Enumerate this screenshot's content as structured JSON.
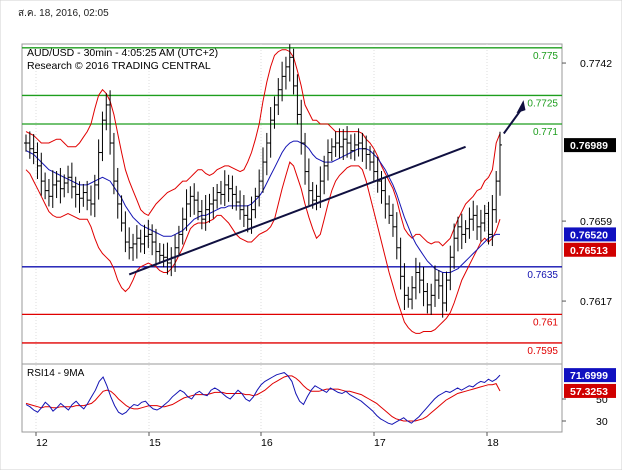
{
  "page": {
    "datestamp": "ส.ค. 18, 2016, 02:05"
  },
  "chart_data": {
    "type": "candlestick",
    "title": "AUD/USD - 30min - 4:05:25 AM (UTC+2)",
    "subtitle": "Research © 2016 TRADING CENTRAL",
    "xlabel": "",
    "ylabel": "",
    "x_ticks": [
      "12",
      "15",
      "16",
      "17",
      "18"
    ],
    "price_axis": {
      "ylim": [
        0.7585,
        0.7752
      ],
      "tick_labels": [
        "0.7742",
        "0.7659",
        "0.7617"
      ],
      "tick_values": [
        0.7742,
        0.7659,
        0.7617
      ]
    },
    "level_lines": [
      {
        "value": 0.775,
        "label": "0.775",
        "color": "#1e9e1e"
      },
      {
        "value": 0.7725,
        "label": "0.7725",
        "color": "#1e9e1e"
      },
      {
        "value": 0.771,
        "label": "0.771",
        "color": "#1e9e1e"
      },
      {
        "value": 0.7635,
        "label": "0.7635",
        "color": "#1010b0"
      },
      {
        "value": 0.761,
        "label": "0.761",
        "color": "#e00000"
      },
      {
        "value": 0.7595,
        "label": "0.7595",
        "color": "#e00000"
      }
    ],
    "price_badges": [
      {
        "label": "0.76989",
        "value": 0.76989,
        "color": "#000000"
      },
      {
        "label": "0.76520",
        "value": 0.7652,
        "color": "#1010c0"
      },
      {
        "label": "0.76513",
        "value": 0.76513,
        "color": "#d00000"
      }
    ],
    "price_series": {
      "name": "close",
      "values": [
        0.77,
        0.7697,
        0.7695,
        0.7688,
        0.768,
        0.7675,
        0.7672,
        0.7678,
        0.768,
        0.7676,
        0.7679,
        0.7682,
        0.7677,
        0.7673,
        0.7671,
        0.7674,
        0.767,
        0.7668,
        0.7678,
        0.7695,
        0.7712,
        0.772,
        0.77,
        0.768,
        0.7668,
        0.7658,
        0.7648,
        0.7645,
        0.7647,
        0.765,
        0.7647,
        0.7651,
        0.7652,
        0.7648,
        0.7643,
        0.7641,
        0.764,
        0.7637,
        0.764,
        0.7645,
        0.7652,
        0.766,
        0.7668,
        0.7672,
        0.767,
        0.7664,
        0.766,
        0.7665,
        0.7668,
        0.767,
        0.7674,
        0.7673,
        0.7678,
        0.7676,
        0.7673,
        0.7669,
        0.7665,
        0.7662,
        0.766,
        0.7665,
        0.7672,
        0.768,
        0.769,
        0.77,
        0.7712,
        0.772,
        0.7728,
        0.7735,
        0.774,
        0.7745,
        0.773,
        0.7715,
        0.77,
        0.7685,
        0.7675,
        0.767,
        0.7672,
        0.768,
        0.7688,
        0.7695,
        0.7698,
        0.77,
        0.7698,
        0.7702,
        0.77,
        0.7696,
        0.7699,
        0.77,
        0.7697,
        0.7694,
        0.769,
        0.7685,
        0.768,
        0.7675,
        0.7668,
        0.7662,
        0.7656,
        0.7645,
        0.763,
        0.762,
        0.7618,
        0.7624,
        0.7632,
        0.7628,
        0.7622,
        0.7615,
        0.762,
        0.7628,
        0.7625,
        0.7616,
        0.7628,
        0.764,
        0.765,
        0.7656,
        0.7652,
        0.7655,
        0.766,
        0.7662,
        0.7656,
        0.7658,
        0.7663,
        0.7652,
        0.7665,
        0.768,
        0.7699
      ]
    },
    "bollinger_upper": {
      "name": "bollinger-upper",
      "values": [
        0.7706,
        0.7705,
        0.7704,
        0.7702,
        0.77,
        0.77,
        0.77,
        0.7701,
        0.7702,
        0.7702,
        0.77,
        0.7698,
        0.7698,
        0.7698,
        0.77,
        0.7703,
        0.7706,
        0.771,
        0.7718,
        0.7725,
        0.7728,
        0.7726,
        0.7722,
        0.7715,
        0.7705,
        0.7695,
        0.7686,
        0.768,
        0.7675,
        0.767,
        0.7665,
        0.7663,
        0.7662,
        0.7665,
        0.7668,
        0.767,
        0.7672,
        0.7674,
        0.7675,
        0.7676,
        0.7678,
        0.768,
        0.768,
        0.7682,
        0.7684,
        0.7686,
        0.7686,
        0.7684,
        0.7683,
        0.7684,
        0.7686,
        0.7687,
        0.7688,
        0.7688,
        0.7687,
        0.7686,
        0.7685,
        0.7686,
        0.769,
        0.7695,
        0.7702,
        0.771,
        0.7722,
        0.7732,
        0.774,
        0.7746,
        0.7748,
        0.7749,
        0.7749,
        0.7748,
        0.7745,
        0.7738,
        0.773,
        0.772,
        0.7716,
        0.7712,
        0.7712,
        0.771,
        0.771,
        0.771,
        0.7708,
        0.7706,
        0.7706,
        0.7706,
        0.7706,
        0.7706,
        0.7706,
        0.7706,
        0.7705,
        0.7702,
        0.77,
        0.7697,
        0.7693,
        0.7688,
        0.7684,
        0.768,
        0.7676,
        0.767,
        0.7662,
        0.7655,
        0.7652,
        0.765,
        0.7652,
        0.7652,
        0.765,
        0.7648,
        0.7647,
        0.7648,
        0.7648,
        0.7646,
        0.7648,
        0.765,
        0.7655,
        0.766,
        0.7664,
        0.7668,
        0.767,
        0.7672,
        0.7675,
        0.7676,
        0.768,
        0.7682,
        0.7686,
        0.77,
        0.7705
      ]
    },
    "bollinger_lower": {
      "name": "bollinger-lower",
      "values": [
        0.7686,
        0.7684,
        0.768,
        0.7676,
        0.7672,
        0.7668,
        0.7664,
        0.7662,
        0.7661,
        0.7661,
        0.7662,
        0.7663,
        0.7662,
        0.7661,
        0.766,
        0.766,
        0.766,
        0.7656,
        0.765,
        0.7645,
        0.7642,
        0.764,
        0.7638,
        0.7634,
        0.7628,
        0.7624,
        0.7622,
        0.7624,
        0.7628,
        0.7633,
        0.7635,
        0.7636,
        0.7637,
        0.7636,
        0.7635,
        0.7633,
        0.7632,
        0.7632,
        0.7634,
        0.7637,
        0.7641,
        0.7645,
        0.765,
        0.7655,
        0.7657,
        0.7658,
        0.7658,
        0.7658,
        0.7659,
        0.766,
        0.7662,
        0.7662,
        0.766,
        0.7658,
        0.7655,
        0.7652,
        0.765,
        0.7649,
        0.7648,
        0.7648,
        0.765,
        0.7652,
        0.7653,
        0.7654,
        0.7656,
        0.766,
        0.7668,
        0.7676,
        0.7683,
        0.769,
        0.7688,
        0.7682,
        0.7676,
        0.7668,
        0.7661,
        0.7655,
        0.765,
        0.7652,
        0.766,
        0.7668,
        0.7675,
        0.768,
        0.7683,
        0.7685,
        0.7687,
        0.7688,
        0.7688,
        0.7688,
        0.7686,
        0.768,
        0.7672,
        0.7664,
        0.7656,
        0.7648,
        0.764,
        0.7632,
        0.7625,
        0.7618,
        0.7612,
        0.7606,
        0.7603,
        0.7601,
        0.76,
        0.76,
        0.7601,
        0.7601,
        0.7601,
        0.7602,
        0.7604,
        0.7606,
        0.7608,
        0.7611,
        0.7616,
        0.7622,
        0.7628,
        0.7632,
        0.7636,
        0.764,
        0.7644,
        0.7648,
        0.765,
        0.7648,
        0.765,
        0.7654,
        0.766
      ]
    },
    "moving_average": {
      "name": "moving-average",
      "values": [
        0.7696,
        0.7695,
        0.7694,
        0.7692,
        0.769,
        0.7688,
        0.7686,
        0.7685,
        0.7684,
        0.7683,
        0.7682,
        0.7681,
        0.768,
        0.7679,
        0.7678,
        0.7678,
        0.7678,
        0.7679,
        0.768,
        0.7681,
        0.7682,
        0.7681,
        0.768,
        0.7677,
        0.7674,
        0.7671,
        0.7667,
        0.7664,
        0.7661,
        0.7659,
        0.7657,
        0.7656,
        0.7655,
        0.7654,
        0.7653,
        0.7652,
        0.7651,
        0.7651,
        0.7651,
        0.7652,
        0.7653,
        0.7654,
        0.7656,
        0.7658,
        0.766,
        0.7661,
        0.7662,
        0.7662,
        0.7663,
        0.7664,
        0.7665,
        0.7666,
        0.7666,
        0.7667,
        0.7667,
        0.7667,
        0.7667,
        0.7667,
        0.7667,
        0.7668,
        0.767,
        0.7672,
        0.7675,
        0.7679,
        0.7683,
        0.7687,
        0.7691,
        0.7695,
        0.7698,
        0.77,
        0.7701,
        0.7701,
        0.77,
        0.7699,
        0.7697,
        0.7694,
        0.7692,
        0.7691,
        0.769,
        0.769,
        0.769,
        0.7691,
        0.7692,
        0.7693,
        0.7694,
        0.7695,
        0.7696,
        0.7697,
        0.7697,
        0.7697,
        0.7696,
        0.7694,
        0.7692,
        0.7689,
        0.7686,
        0.7682,
        0.7678,
        0.7673,
        0.7667,
        0.7661,
        0.7656,
        0.7651,
        0.7647,
        0.7644,
        0.7641,
        0.7638,
        0.7636,
        0.7634,
        0.7633,
        0.7632,
        0.7632,
        0.7632,
        0.7633,
        0.7634,
        0.7636,
        0.7638,
        0.764,
        0.7642,
        0.7644,
        0.7646,
        0.7648,
        0.765,
        0.7651,
        0.7652,
        0.7652
      ]
    },
    "trendline": {
      "from": {
        "x_index": 27,
        "y": 0.7631
      },
      "to": {
        "x_index": 115,
        "y": 0.7698
      }
    },
    "target_arrow": {
      "from": {
        "x_index": 125,
        "y": 0.7705
      },
      "to": {
        "x_index": 127,
        "y": 0.7722
      }
    },
    "rsi_panel": {
      "label": "RSI14 - 9MA",
      "ylim": [
        20,
        80
      ],
      "tick_labels": [
        "50",
        "30"
      ],
      "tick_values": [
        50,
        30
      ],
      "badges": [
        {
          "label": "71.6999",
          "value": 71.6999,
          "color": "#1010c0"
        },
        {
          "label": "57.3253",
          "value": 57.3253,
          "color": "#d00000"
        }
      ],
      "rsi": {
        "name": "rsi",
        "values": [
          45,
          43,
          40,
          38,
          42,
          47,
          44,
          39,
          42,
          46,
          43,
          40,
          45,
          48,
          44,
          41,
          46,
          52,
          58,
          66,
          70,
          62,
          52,
          44,
          38,
          36,
          38,
          42,
          45,
          44,
          47,
          48,
          44,
          41,
          40,
          42,
          45,
          48,
          52,
          55,
          58,
          56,
          52,
          50,
          55,
          57,
          54,
          53,
          58,
          60,
          58,
          55,
          52,
          50,
          54,
          58,
          55,
          50,
          48,
          52,
          58,
          63,
          66,
          68,
          70,
          72,
          73,
          74,
          71,
          66,
          55,
          48,
          45,
          52,
          58,
          62,
          60,
          58,
          56,
          60,
          58,
          56,
          55,
          57,
          54,
          52,
          50,
          48,
          45,
          42,
          39,
          35,
          32,
          30,
          28,
          27,
          29,
          31,
          33,
          30,
          28,
          31,
          34,
          38,
          42,
          46,
          50,
          53,
          55,
          57,
          56,
          58,
          60,
          58,
          60,
          62,
          61,
          64,
          66,
          65,
          68,
          66,
          68,
          71.7
        ]
      },
      "ma": {
        "name": "rsi-ma",
        "values": [
          46,
          45,
          44,
          43,
          42,
          43,
          43,
          42,
          42,
          43,
          43,
          43,
          43,
          44,
          44,
          44,
          45,
          46,
          49,
          53,
          57,
          58,
          57,
          54,
          50,
          47,
          44,
          42,
          41,
          41,
          42,
          43,
          44,
          44,
          44,
          43,
          43,
          44,
          45,
          47,
          49,
          51,
          52,
          53,
          54,
          54,
          54,
          54,
          55,
          56,
          56,
          56,
          55,
          55,
          55,
          55,
          55,
          54,
          54,
          53,
          54,
          56,
          58,
          61,
          64,
          66,
          68,
          70,
          71,
          71,
          69,
          66,
          62,
          59,
          57,
          57,
          57,
          58,
          59,
          59,
          59,
          59,
          58,
          57,
          57,
          56,
          55,
          54,
          52,
          50,
          48,
          46,
          43,
          40,
          37,
          34,
          32,
          31,
          30,
          30,
          30,
          30,
          31,
          32,
          34,
          37,
          40,
          43,
          46,
          49,
          51,
          53,
          55,
          56,
          57,
          58,
          59,
          60,
          61,
          62,
          63,
          63,
          64,
          57.3
        ]
      }
    }
  }
}
